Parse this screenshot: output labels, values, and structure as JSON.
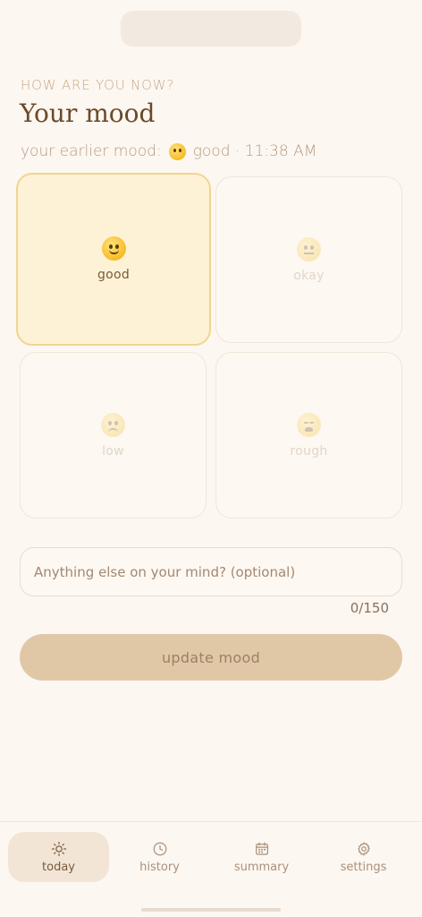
{
  "header": {
    "eyebrow": "HOW ARE YOU NOW?",
    "title": "Your mood",
    "earlier_prefix": "your earlier mood:",
    "earlier_emoji": "slightly-smiling-face",
    "earlier_value": "good · 11:38 AM"
  },
  "moods": [
    {
      "label": "good",
      "icon": "slightly-smiling-face",
      "selected": true
    },
    {
      "label": "okay",
      "icon": "neutral-face",
      "selected": false
    },
    {
      "label": "low",
      "icon": "slightly-frowning-face",
      "selected": false
    },
    {
      "label": "rough",
      "icon": "tired-face",
      "selected": false
    }
  ],
  "note": {
    "placeholder": "Anything else on your mind? (optional)",
    "value": "",
    "counter": "0/150"
  },
  "actions": {
    "update_label": "update mood"
  },
  "nav": {
    "items": [
      {
        "label": "today",
        "icon": "sun-icon",
        "active": true
      },
      {
        "label": "history",
        "icon": "clock-icon",
        "active": false
      },
      {
        "label": "summary",
        "icon": "calendar-icon",
        "active": false
      },
      {
        "label": "settings",
        "icon": "gear-icon",
        "active": false
      }
    ]
  },
  "colors": {
    "background": "#fdf7f1",
    "accent": "#e0c8a7",
    "selected_card": "#fef2d6",
    "selected_border": "#f0d590",
    "title": "#6b4a2a"
  }
}
